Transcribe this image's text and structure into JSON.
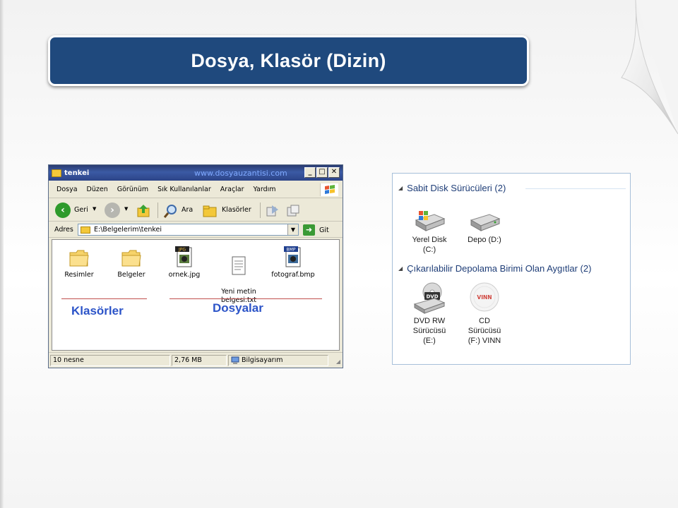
{
  "slide": {
    "title": "Dosya, Klasör (Dizin)"
  },
  "explorer": {
    "window_title": "tenkei",
    "watermark": "www.dosyauzantisi.com",
    "controls": {
      "minimize": "_",
      "maximize": "□",
      "close": "✕"
    },
    "menu": [
      "Dosya",
      "Düzen",
      "Görünüm",
      "Sık Kullanılanlar",
      "Araçlar",
      "Yardım"
    ],
    "toolbar": {
      "back": "Geri",
      "search": "Ara",
      "folders": "Klasörler"
    },
    "address": {
      "label": "Adres",
      "path": "E:\\Belgelerim\\tenkei",
      "go": "Git"
    },
    "items": [
      {
        "name": "Resimler",
        "type": "folder"
      },
      {
        "name": "Belgeler",
        "type": "folder"
      },
      {
        "name": "ornek.jpg",
        "type": "jpg",
        "badge": "JPG"
      },
      {
        "name": "Yeni metin\nbelgesi.txt",
        "type": "txt"
      },
      {
        "name": "fotograf.bmp",
        "type": "bmp",
        "badge": "BMP"
      }
    ],
    "annotations": {
      "folders_label": "Klasörler",
      "files_label": "Dosyalar"
    },
    "status": {
      "count": "10 nesne",
      "size": "2,76 MB",
      "location": "Bilgisayarım"
    },
    "colors": {
      "annotation": "#2c54c8",
      "underline": "#c0504d",
      "titlebar": "#2c4387"
    }
  },
  "drives": {
    "groups": [
      {
        "header": "Sabit Disk Sürücüleri (2)",
        "items": [
          {
            "label": "Yerel Disk\n(C:)",
            "icon": "hard-drive-windows-icon"
          },
          {
            "label": "Depo (D:)",
            "icon": "hard-drive-icon"
          }
        ]
      },
      {
        "header": "Çıkarılabilir Depolama Birimi Olan Aygıtlar (2)",
        "items": [
          {
            "label": "DVD RW\nSürücüsü\n(E:)",
            "icon": "dvd-drive-icon",
            "badge": "DVD"
          },
          {
            "label": "CD\nSürücüsü\n(F:) VINN",
            "icon": "cd-disc-icon",
            "badge": "VINN"
          }
        ]
      }
    ]
  }
}
